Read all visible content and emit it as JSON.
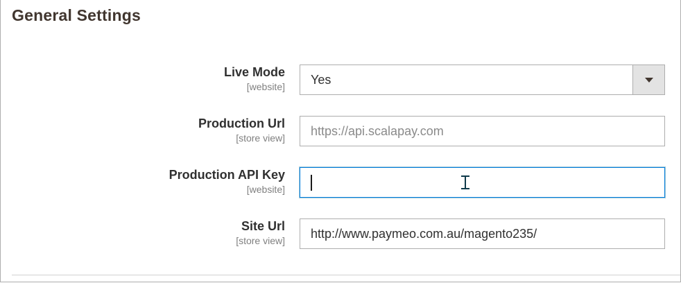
{
  "section": {
    "title": "General Settings"
  },
  "rows": [
    {
      "label": "Live Mode",
      "scope": "[website]",
      "control": "select",
      "value": "Yes",
      "icon": "chevron-down-icon"
    },
    {
      "label": "Production Url",
      "scope": "[store view]",
      "control": "text",
      "value": "",
      "placeholder": "https://api.scalapay.com"
    },
    {
      "label": "Production API Key",
      "scope": "[website]",
      "control": "text",
      "value": "",
      "placeholder": "",
      "focused": true
    },
    {
      "label": "Site Url",
      "scope": "[store view]",
      "control": "text",
      "value": "http://www.paymeo.com.au/magento235/"
    }
  ],
  "colors": {
    "title": "#41362f",
    "label": "#303030",
    "scope": "#808080",
    "border": "#adadad",
    "focus_border": "#007bdb",
    "select_button": "#e3e3e3"
  }
}
